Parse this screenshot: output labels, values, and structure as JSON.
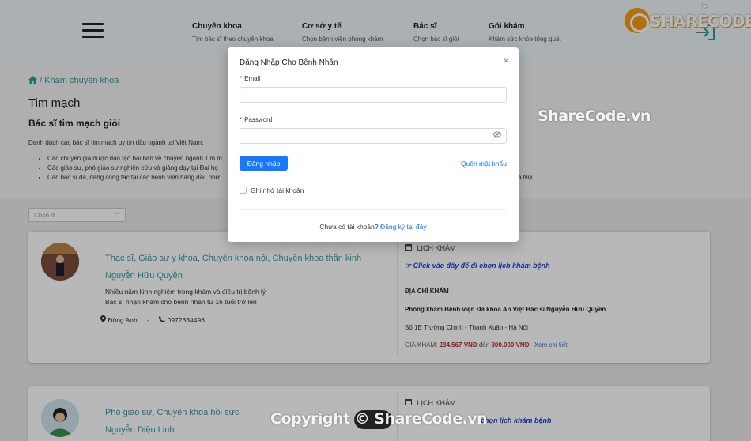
{
  "header": {
    "nav": [
      {
        "title": "Chuyên khoa",
        "subtitle": "Tìm bác sĩ theo chuyên khoa"
      },
      {
        "title": "Cơ sở y tế",
        "subtitle": "Chọn bệnh viện phòng khám"
      },
      {
        "title": "Bác sĩ",
        "subtitle": "Chọn bác sĩ giỏi"
      },
      {
        "title": "Gói khám",
        "subtitle": "Khám sức khỏe tổng quát"
      }
    ],
    "logo_text": "SHARECODE.vn"
  },
  "breadcrumb": {
    "separator": "/",
    "current": "Khám chuyên khoa"
  },
  "specialty": {
    "title": "Tim mạch",
    "subtitle": "Bác sĩ tim mạch giỏi",
    "description": "Danh dách các bác sĩ tim mạch uy tín đầu ngành tại Việt Nam:",
    "bullets": [
      "Các chuyên gia được đào tạo bài bản về chuyên ngành Tim m",
      "Các giáo sư, phó giáo sư nghiên cứu và giảng dạy tại Đại họ",
      "Các bác sĩ đã, đang công tác tại các bệnh viện hàng đầu như"
    ],
    "bullet_tail": "à Nội"
  },
  "filter": {
    "placeholder": "Chọn đị..."
  },
  "doctors": [
    {
      "title": "Thạc sĩ, Giáo sư y khoa, Chuyên khoa nội, Chuyên khoa thần kinh",
      "name": "Nguyễn Hữu Quyền",
      "desc_1": "Nhiều năm kinh nghiệm trong khám và điều trị bệnh lý",
      "desc_2": "Bác sĩ nhận khám cho bệnh nhân từ 16 tuổi trở lên",
      "location": "Đông Anh",
      "separator": "-",
      "phone": "0972334493",
      "schedule_head": "LỊCH KHÁM",
      "schedule_link": "Click vào đây để đi chọn lịch khám bệnh",
      "address_head": "ĐỊA CHỈ KHÁM",
      "clinic": "Phòng khám Bệnh viện Đa khoa An Việt Bác sĩ Nguyễn Hữu Quyền",
      "address": "Số 1E Trường Chinh - Thanh Xuân - Hà Nội",
      "price_label": "GIÁ KHÁM:",
      "price_from": "234.567 VNĐ",
      "price_mid": "đến",
      "price_to": "300.000 VNĐ",
      "detail_link": "Xem chi tiết"
    },
    {
      "title": "Phó giáo sư, Chuyên khoa hồi sức",
      "name": "Nguyễn Diệu Linh",
      "schedule_head": "LỊCH KHÁM",
      "schedule_link": "chọn lịch khám bệnh"
    }
  ],
  "modal": {
    "title": "Đăng Nhập Cho Bệnh Nhân",
    "close": "×",
    "email_label": "Email",
    "email_value": "",
    "password_label": "Password",
    "password_value": "",
    "required_mark": "*",
    "login_button": "Đăng nhập",
    "forgot": "Quên mật khẩu",
    "remember": "Ghi nhớ tài khoản",
    "register_prompt": "Chưa có tài khoản?",
    "register_link": "Đăng ký tại đây"
  },
  "watermarks": {
    "top": "ShareCode.vn",
    "bottom": "Copyright © ShareCode.vn"
  },
  "icons": {
    "menu": "hamburger-icon",
    "login": "login-arrow-icon",
    "home": "home-icon",
    "location": "map-pin-icon",
    "phone": "phone-icon",
    "calendar": "calendar-icon",
    "hand": "pointer-hand-icon",
    "eye": "eye-icon"
  },
  "colors": {
    "accent": "#2f9aa3",
    "primary_button": "#1677ff",
    "price_red": "#c0282b",
    "schedule_link": "#1a3fd0"
  }
}
